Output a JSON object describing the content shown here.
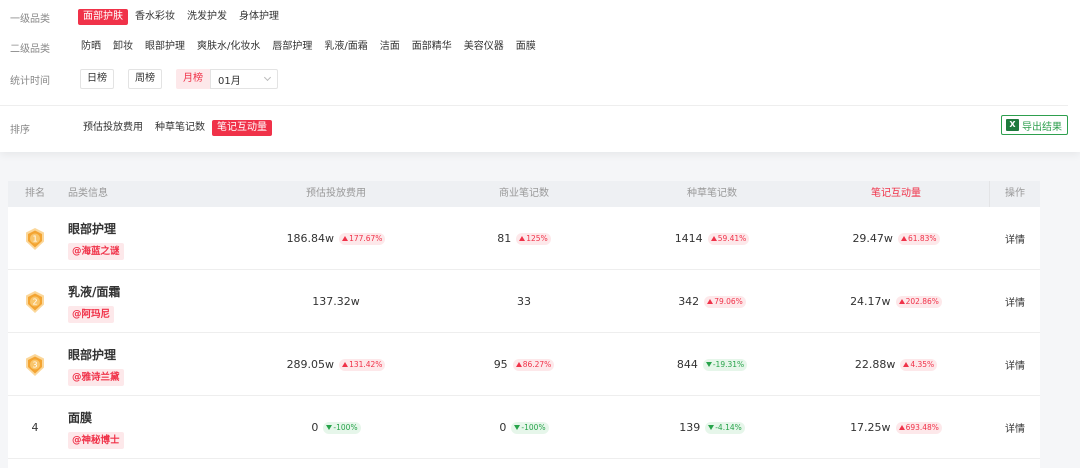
{
  "filters": {
    "level1": {
      "label": "一级品类",
      "options": [
        "面部护肤",
        "香水彩妆",
        "洗发护发",
        "身体护理"
      ],
      "active": 0
    },
    "level2": {
      "label": "二级品类",
      "options": [
        "防晒",
        "卸妆",
        "眼部护理",
        "爽肤水/化妆水",
        "唇部护理",
        "乳液/面霜",
        "洁面",
        "面部精华",
        "美容仪器",
        "面膜"
      ]
    },
    "time": {
      "label": "统计时间",
      "day": "日榜",
      "week": "周榜",
      "month": "月榜",
      "month_value": "01月"
    },
    "sort": {
      "label": "排序",
      "options": [
        "预估投放费用",
        "种草笔记数",
        "笔记互动量"
      ],
      "active": 2
    },
    "export_label": "导出结果",
    "export_icon": "excel-icon"
  },
  "table": {
    "headers": {
      "rank": "排名",
      "category": "品类信息",
      "spend": "预估投放费用",
      "commercial": "商业笔记数",
      "seeding": "种草笔记数",
      "interaction": "笔记互动量",
      "action": "操作"
    },
    "highlight_color": "#f03249",
    "rows": [
      {
        "rank": "1",
        "medal": true,
        "category": "眼部护理",
        "brand": "@海蓝之谜",
        "spend": "186.84w",
        "spend_chg": "177.67%",
        "spend_dir": "up",
        "commercial": "81",
        "commercial_chg": "125%",
        "commercial_dir": "up",
        "seeding": "1414",
        "seeding_chg": "59.41%",
        "seeding_dir": "up",
        "interaction": "29.47w",
        "interaction_chg": "61.83%",
        "interaction_dir": "up",
        "action": "详情"
      },
      {
        "rank": "2",
        "medal": true,
        "category": "乳液/面霜",
        "brand": "@阿玛尼",
        "spend": "137.32w",
        "spend_chg": "",
        "spend_dir": "",
        "commercial": "33",
        "commercial_chg": "",
        "commercial_dir": "",
        "seeding": "342",
        "seeding_chg": "79.06%",
        "seeding_dir": "up",
        "interaction": "24.17w",
        "interaction_chg": "202.86%",
        "interaction_dir": "up",
        "action": "详情"
      },
      {
        "rank": "3",
        "medal": true,
        "category": "眼部护理",
        "brand": "@雅诗兰黛",
        "spend": "289.05w",
        "spend_chg": "131.42%",
        "spend_dir": "up",
        "commercial": "95",
        "commercial_chg": "86.27%",
        "commercial_dir": "up",
        "seeding": "844",
        "seeding_chg": "-19.31%",
        "seeding_dir": "down",
        "interaction": "22.88w",
        "interaction_chg": "4.35%",
        "interaction_dir": "up",
        "action": "详情"
      },
      {
        "rank": "4",
        "medal": false,
        "category": "面膜",
        "brand": "@神秘博士",
        "spend": "0",
        "spend_chg": "-100%",
        "spend_dir": "down",
        "commercial": "0",
        "commercial_chg": "-100%",
        "commercial_dir": "down",
        "seeding": "139",
        "seeding_chg": "-4.14%",
        "seeding_dir": "down",
        "interaction": "17.25w",
        "interaction_chg": "693.48%",
        "interaction_dir": "up",
        "action": "详情"
      }
    ]
  }
}
